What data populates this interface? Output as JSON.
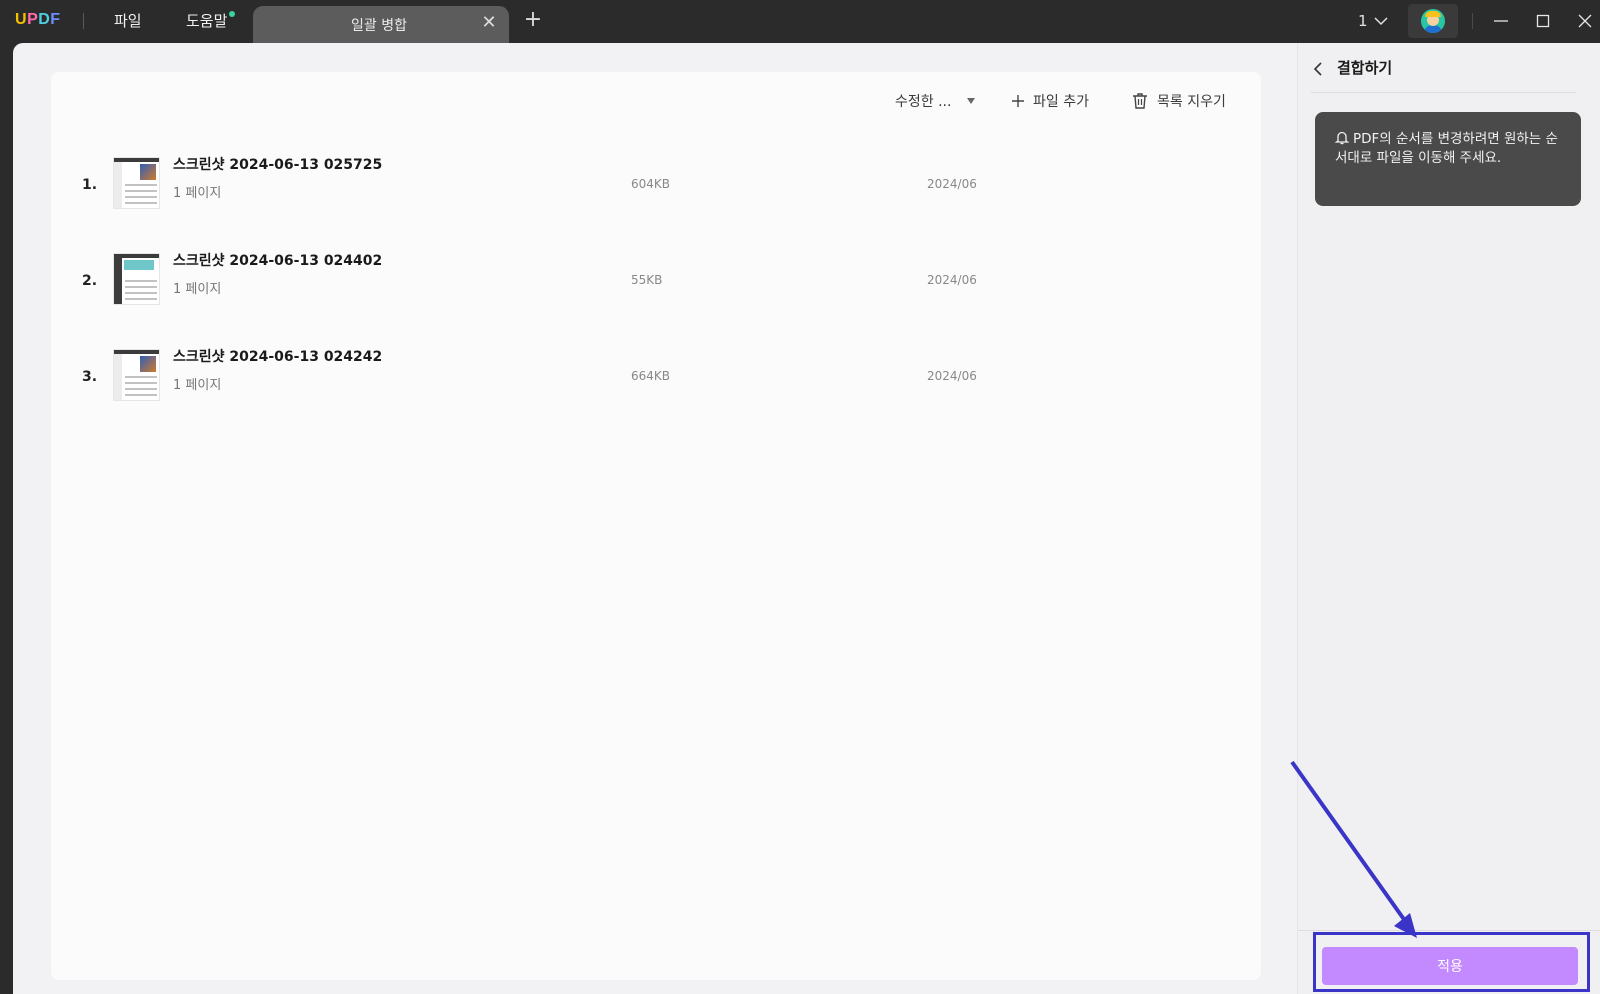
{
  "titlebar": {
    "logo": {
      "u": "U",
      "p": "P",
      "d": "D",
      "f": "F"
    },
    "menu": {
      "file": "파일",
      "help": "도움말"
    },
    "tab": {
      "title": "일괄 병합",
      "close": "✕"
    },
    "add_tab": "+",
    "page_count": "1"
  },
  "toolbar": {
    "sort_label": "수정한 ...",
    "add_file_label": "파일 추가",
    "clear_list_label": "목록 지우기"
  },
  "files": [
    {
      "index": "1.",
      "name": "스크린샷 2024-06-13 025725",
      "pages": "1 페이지",
      "size": "604KB",
      "date": "2024/06"
    },
    {
      "index": "2.",
      "name": "스크린샷 2024-06-13 024402",
      "pages": "1 페이지",
      "size": "55KB",
      "date": "2024/06"
    },
    {
      "index": "3.",
      "name": "스크린샷 2024-06-13 024242",
      "pages": "1 페이지",
      "size": "664KB",
      "date": "2024/06"
    }
  ],
  "panel": {
    "title": "결합하기",
    "notice": "PDF의 순서를 변경하려면 원하는 순서대로 파일을 이동해 주세요.",
    "apply_label": "적용"
  },
  "colors": {
    "apply_button": "#c389ff",
    "annotation": "#3a35c7",
    "titlebar": "#2b2b2b"
  },
  "icons": {
    "tab_close": "close-icon",
    "add_tab": "plus-icon",
    "page_dropdown": "chevron-down-icon",
    "sort_dropdown": "caret-down-icon",
    "add_file": "plus-icon",
    "clear_list": "trash-icon",
    "back": "chevron-left-icon",
    "notice": "bell-icon",
    "minimize": "minimize-icon",
    "maximize": "maximize-icon",
    "close": "close-icon"
  }
}
